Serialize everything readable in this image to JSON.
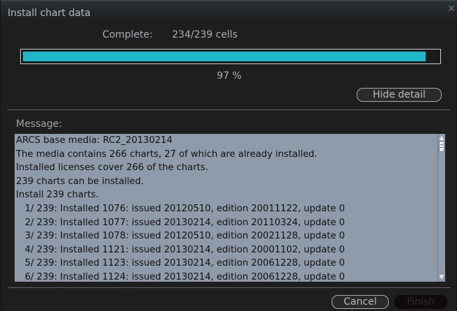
{
  "window": {
    "title": "Install chart data"
  },
  "progress": {
    "complete_label": "Complete:",
    "complete_value": "234/239 cells",
    "fraction": 0.97,
    "percent_text": "97 %"
  },
  "buttons": {
    "hide_detail": "Hide detail",
    "cancel": "Cancel",
    "finish": "Finish"
  },
  "message": {
    "label": "Message:",
    "lines": [
      "ARCS base media: RC2_20130214",
      "The media contains 266 charts, 27 of which are already installed.",
      "Installed licenses cover 266 of the charts.",
      "239 charts can be installed.",
      "Install 239 charts.",
      "   1/ 239: Installed 1076: issued 20120510, edition 20011122, update 0",
      "   2/ 239: Installed 1077: issued 20130214, edition 20110324, update 0",
      "   3/ 239: Installed 1078: issued 20120510, edition 20021128, update 0",
      "   4/ 239: Installed 1121: issued 20130214, edition 20001102, update 0",
      "   5/ 239: Installed 1123: issued 20130214, edition 20061228, update 0",
      "   6/ 239: Installed 1124: issued 20130214, edition 20061228, update 0"
    ]
  },
  "colors": {
    "progress_fill": "#1fb6c8",
    "log_background": "#8f9bab",
    "finish_disabled_text": "#3a2330"
  }
}
